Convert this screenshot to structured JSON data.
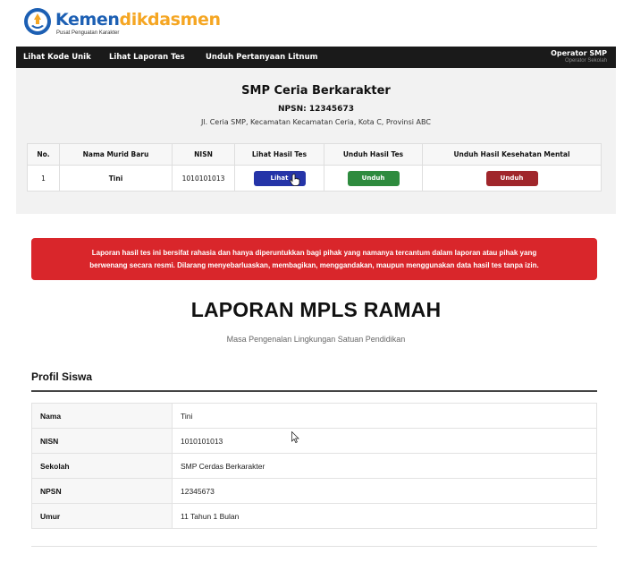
{
  "brand": {
    "name_part1": "Kemen",
    "name_part2": "dikdasmen",
    "tagline": "Pusat Penguatan Karakter",
    "colors": {
      "blue": "#1c5fb3",
      "orange": "#f5a623"
    }
  },
  "nav": {
    "items": [
      {
        "label": "Lihat Kode Unik"
      },
      {
        "label": "Lihat Laporan Tes"
      },
      {
        "label": "Unduh Pertanyaan Litnum"
      }
    ],
    "user_name": "Operator SMP",
    "user_role": "Operator Sekolah"
  },
  "school": {
    "name": "SMP Ceria Berkarakter",
    "npsn_line": "NPSN: 12345673",
    "address": "Jl. Ceria SMP, Kecamatan Kecamatan Ceria, Kota C, Provinsi ABC"
  },
  "student_table": {
    "headers": [
      "No.",
      "Nama Murid Baru",
      "NISN",
      "Lihat Hasil Tes",
      "Unduh Hasil Tes",
      "Unduh Hasil Kesehatan Mental"
    ],
    "rows": [
      {
        "no": "1",
        "name": "Tini",
        "nisn": "1010101013",
        "view_label": "Lihat",
        "download_label": "Unduh",
        "mental_label": "Unduh"
      }
    ],
    "button_colors": {
      "view": "#2534a8",
      "download": "#2e8b3e",
      "mental": "#a0262b"
    }
  },
  "alert": {
    "line1": "Laporan hasil tes ini bersifat rahasia dan hanya diperuntukkan bagi pihak yang namanya tercantum dalam laporan atau pihak yang",
    "line2": "berwenang secara resmi. Dilarang menyebarluaskan, membagikan, menggandakan, maupun menggunakan data hasil tes tanpa izin.",
    "color": "#d9262b"
  },
  "report": {
    "title": "LAPORAN MPLS RAMAH",
    "subtitle": "Masa Pengenalan Lingkungan Satuan Pendidikan",
    "section_heading": "Profil Siswa",
    "profile": [
      {
        "label": "Nama",
        "value": "Tini"
      },
      {
        "label": "NISN",
        "value": "1010101013"
      },
      {
        "label": "Sekolah",
        "value": "SMP Cerdas Berkarakter"
      },
      {
        "label": "NPSN",
        "value": "12345673"
      },
      {
        "label": "Umur",
        "value": "11 Tahun 1 Bulan"
      }
    ]
  },
  "icons": {
    "logo": "tut-wuri-handayani-emblem",
    "hand_cursor": "hand-pointer-icon",
    "mouse_pointer": "arrow-cursor-icon"
  }
}
